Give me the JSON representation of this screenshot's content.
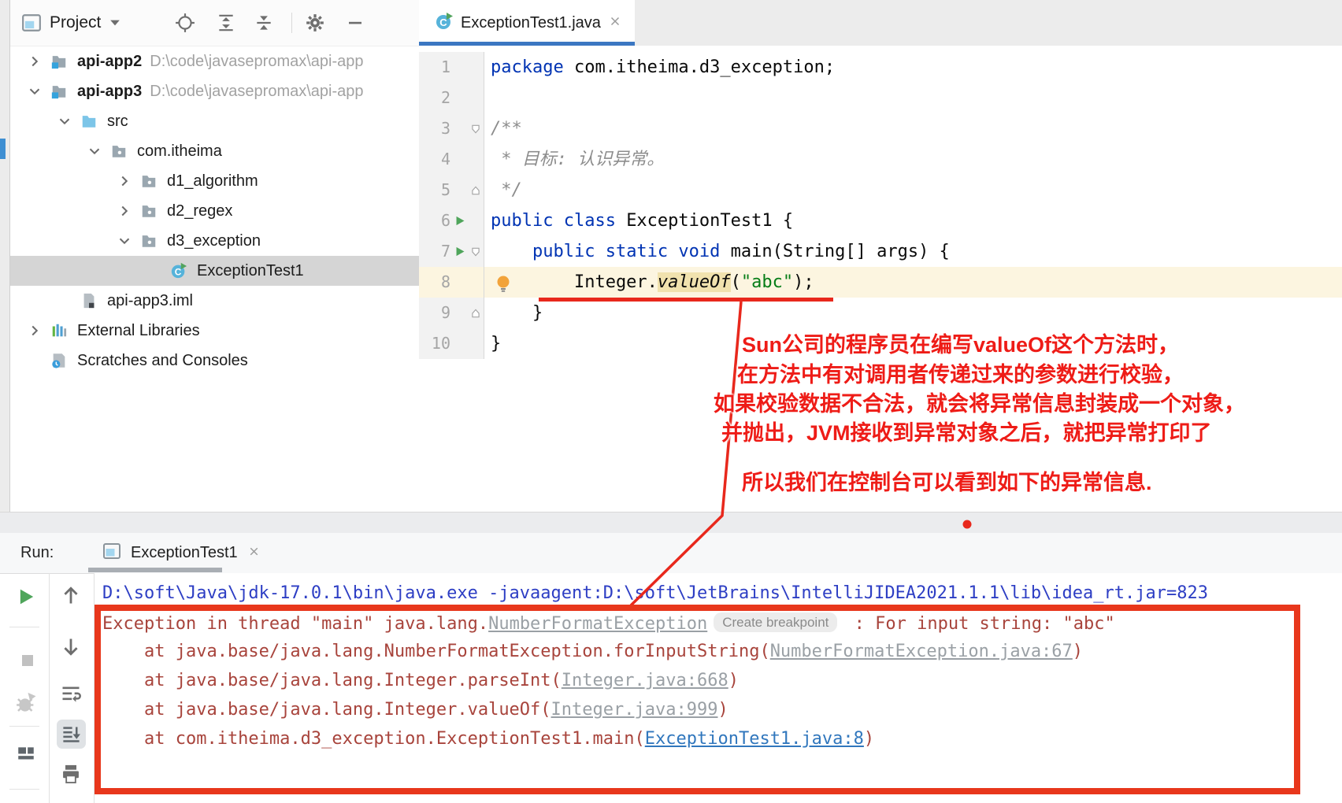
{
  "colors": {
    "annotation_red": "#e8281c",
    "box_red": "#e8371c",
    "tab_accent_blue": "#3b77c2",
    "error_red": "#a8443c",
    "keyword_blue": "#0033b3",
    "string_green": "#067d17",
    "caret_row": "#fcf5e0",
    "selection_gray": "#d5d5d5"
  },
  "project_panel": {
    "title": "Project",
    "tree": [
      {
        "indent": 0,
        "chevron": "right",
        "icon": "module-folder",
        "label": "api-app2",
        "bold": true,
        "path": "D:\\code\\javasepromax\\api-app"
      },
      {
        "indent": 0,
        "chevron": "down",
        "icon": "module-folder",
        "label": "api-app3",
        "bold": true,
        "path": "D:\\code\\javasepromax\\api-app"
      },
      {
        "indent": 1,
        "chevron": "down",
        "icon": "src-folder",
        "label": "src"
      },
      {
        "indent": 2,
        "chevron": "down",
        "icon": "package-folder",
        "label": "com.itheima"
      },
      {
        "indent": 3,
        "chevron": "right",
        "icon": "package-folder",
        "label": "d1_algorithm"
      },
      {
        "indent": 3,
        "chevron": "right",
        "icon": "package-folder",
        "label": "d2_regex"
      },
      {
        "indent": 3,
        "chevron": "down",
        "icon": "package-folder",
        "label": "d3_exception"
      },
      {
        "indent": 4,
        "chevron": null,
        "icon": "class-run",
        "label": "ExceptionTest1",
        "selected": true
      },
      {
        "indent": 1,
        "chevron": null,
        "icon": "iml-file",
        "label": "api-app3.iml"
      },
      {
        "indent": 0,
        "chevron": "right",
        "icon": "libraries",
        "label": "External Libraries"
      },
      {
        "indent": 0,
        "chevron": null,
        "icon": "scratches",
        "label": "Scratches and Consoles"
      }
    ]
  },
  "editor": {
    "tab": {
      "label": "ExceptionTest1.java"
    },
    "lines": [
      {
        "num": "1",
        "segs": [
          [
            "kw",
            "package "
          ],
          [
            "pl",
            "com.itheima.d3_exception;"
          ]
        ]
      },
      {
        "num": "2",
        "segs": []
      },
      {
        "num": "3",
        "fold": "down",
        "segs": [
          [
            "cmt",
            "/**"
          ]
        ]
      },
      {
        "num": "4",
        "segs": [
          [
            "cmt",
            " * 目标: 认识异常。"
          ]
        ]
      },
      {
        "num": "5",
        "fold": "up",
        "segs": [
          [
            "cmt",
            " */"
          ]
        ]
      },
      {
        "num": "6",
        "run": true,
        "segs": [
          [
            "kw",
            "public class "
          ],
          [
            "pl",
            "ExceptionTest1 {"
          ]
        ]
      },
      {
        "num": "7",
        "run": true,
        "fold": "down",
        "segs": [
          [
            "pl",
            "    "
          ],
          [
            "kw",
            "public static void "
          ],
          [
            "pl",
            "main(String[] args) {"
          ]
        ]
      },
      {
        "num": "8",
        "bulb": true,
        "caret": true,
        "segs": [
          [
            "pl",
            "        Integer."
          ],
          [
            "mi",
            "valueOf"
          ],
          [
            "pl",
            "("
          ],
          [
            "str",
            "\"abc\""
          ],
          [
            "pl",
            ");"
          ]
        ]
      },
      {
        "num": "9",
        "fold": "up",
        "segs": [
          [
            "pl",
            "    }"
          ]
        ]
      },
      {
        "num": "10",
        "segs": [
          [
            "pl",
            "}"
          ]
        ]
      }
    ]
  },
  "annotations": {
    "lines": [
      "Sun公司的程序员在编写valueOf这个方法时，",
      "在方法中有对调用者传递过来的参数进行校验，",
      "如果校验数据不合法，就会将异常信息封装成一个对象，",
      "并抛出，JVM接收到异常对象之后，就把异常打印了",
      "所以我们在控制台可以看到如下的异常信息."
    ]
  },
  "run_panel": {
    "label": "Run:",
    "tab": {
      "label": "ExceptionTest1"
    },
    "console_lines": [
      {
        "segs": [
          [
            "cmd",
            "D:\\soft\\Java\\jdk-17.0.1\\bin\\java.exe -javaagent:D:\\soft\\JetBrains\\IntelliJIDEA2021.1.1\\lib\\idea_rt.jar=823"
          ]
        ]
      },
      {
        "segs": [
          [
            "err",
            "Exception in thread \"main\" java.lang."
          ],
          [
            "linkgray",
            "NumberFormatException"
          ],
          [
            "pill",
            "Create breakpoint"
          ],
          [
            "err",
            " : For input string: \"abc\""
          ]
        ]
      },
      {
        "segs": [
          [
            "err",
            "    at java.base/java.lang.NumberFormatException.forInputString("
          ],
          [
            "linkgray",
            "NumberFormatException.java:67"
          ],
          [
            "err",
            ")"
          ]
        ]
      },
      {
        "segs": [
          [
            "err",
            "    at java.base/java.lang.Integer.parseInt("
          ],
          [
            "linkgray",
            "Integer.java:668"
          ],
          [
            "err",
            ")"
          ]
        ]
      },
      {
        "segs": [
          [
            "err",
            "    at java.base/java.lang.Integer.valueOf("
          ],
          [
            "linkgray",
            "Integer.java:999"
          ],
          [
            "err",
            ")"
          ]
        ]
      },
      {
        "segs": [
          [
            "err",
            "    at com.itheima.d3_exception.ExceptionTest1.main("
          ],
          [
            "linkblue",
            "ExceptionTest1.java:8"
          ],
          [
            "err",
            ")"
          ]
        ]
      }
    ]
  }
}
